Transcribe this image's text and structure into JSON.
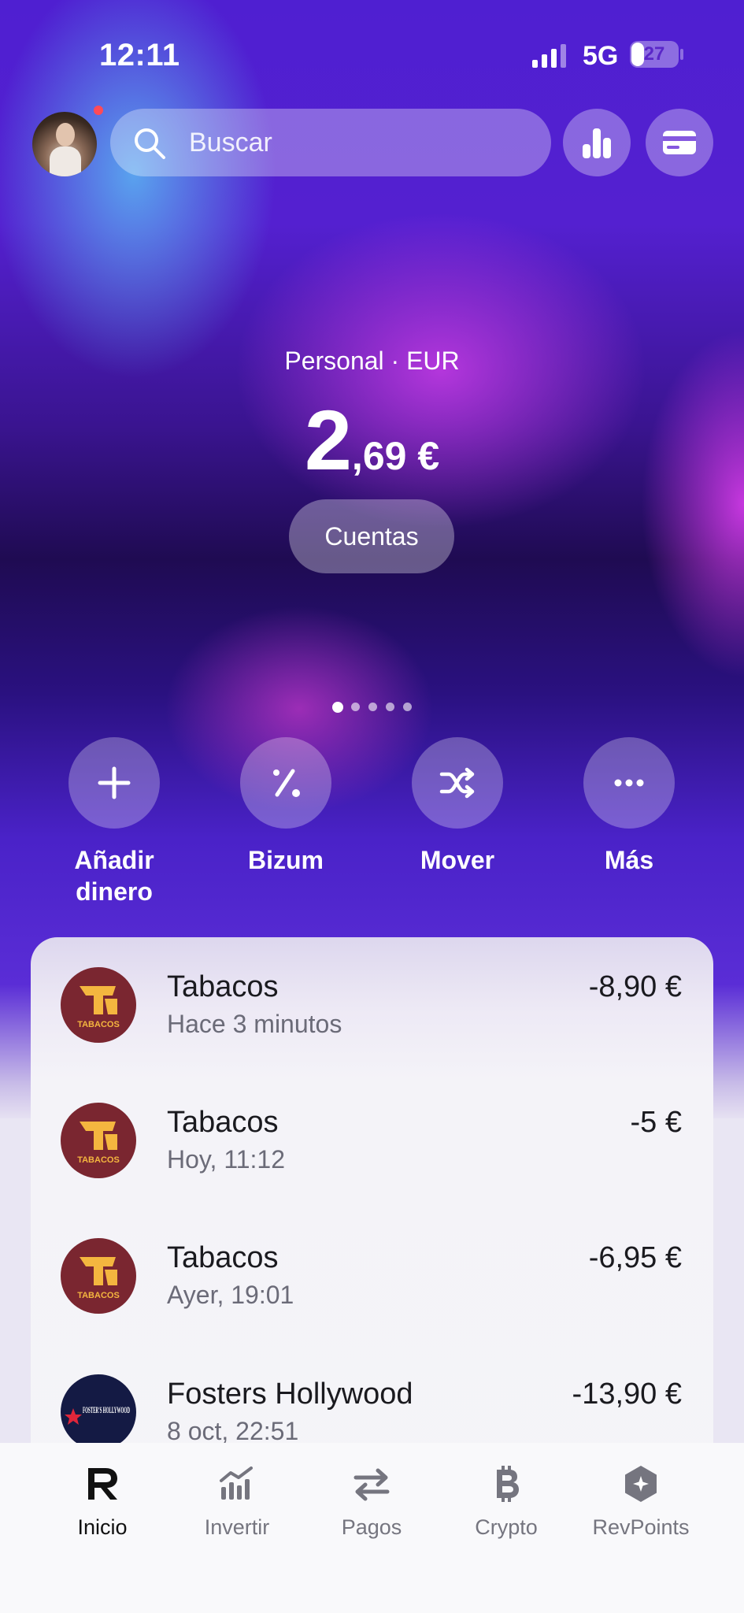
{
  "status_bar": {
    "time": "12:11",
    "network": "5G",
    "battery": "27",
    "battery_level": 0.27
  },
  "header": {
    "search_placeholder": "Buscar"
  },
  "balance": {
    "account_label": "Personal · EUR",
    "integer": "2",
    "decimal": ",69 €",
    "accounts_button": "Cuentas"
  },
  "pager": {
    "count": 5,
    "active_index": 0
  },
  "actions": [
    {
      "label": "Añadir dinero",
      "icon": "plus-icon"
    },
    {
      "label": "Bizum",
      "icon": "bizum-icon"
    },
    {
      "label": "Mover",
      "icon": "shuffle-icon"
    },
    {
      "label": "Más",
      "icon": "more-icon"
    }
  ],
  "transactions": [
    {
      "name": "Tabacos",
      "time": "Hace 3 minutos",
      "amount": "-8,90 €",
      "logo": "tabacos-logo",
      "logo_text": "TABACOS"
    },
    {
      "name": "Tabacos",
      "time": "Hoy, 11:12",
      "amount": "-5 €",
      "logo": "tabacos-logo",
      "logo_text": "TABACOS"
    },
    {
      "name": "Tabacos",
      "time": "Ayer, 19:01",
      "amount": "-6,95 €",
      "logo": "tabacos-logo",
      "logo_text": "TABACOS"
    },
    {
      "name": "Fosters Hollywood",
      "time": "8 oct, 22:51",
      "amount": "-13,90 €",
      "logo": "fosters-logo",
      "logo_text": "FOSTER'S HOLLYWOOD"
    }
  ],
  "nav": [
    {
      "label": "Inicio",
      "icon": "revolut-r-icon",
      "active": true
    },
    {
      "label": "Invertir",
      "icon": "chart-icon",
      "active": false
    },
    {
      "label": "Pagos",
      "icon": "transfer-icon",
      "active": false
    },
    {
      "label": "Crypto",
      "icon": "bitcoin-icon",
      "active": false
    },
    {
      "label": "RevPoints",
      "icon": "hexagon-star-icon",
      "active": false
    }
  ],
  "colors": {
    "accent": "#5a26c8",
    "tabacos_red": "#7a2630",
    "tabacos_yellow": "#f4b63f",
    "fosters_navy": "#141a44"
  }
}
